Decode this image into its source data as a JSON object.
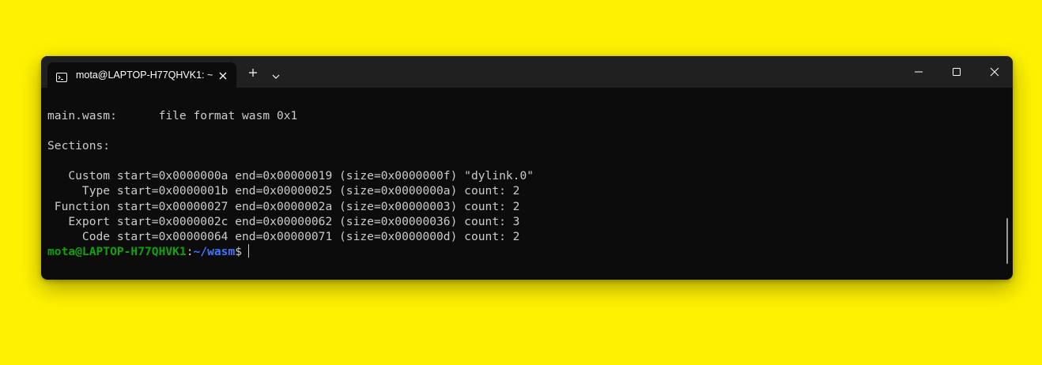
{
  "tab": {
    "title": "mota@LAPTOP-H77QHVK1: ~",
    "icon": "terminal-icon"
  },
  "titlebar": {
    "new_tab_icon": "plus-icon",
    "dropdown_icon": "chevron-down-icon",
    "minimize_icon": "minimize-icon",
    "maximize_icon": "maximize-icon",
    "close_icon": "close-icon"
  },
  "terminal": {
    "lines": [
      "main.wasm:      file format wasm 0x1",
      "",
      "Sections:",
      "",
      "   Custom start=0x0000000a end=0x00000019 (size=0x0000000f) \"dylink.0\"",
      "     Type start=0x0000001b end=0x00000025 (size=0x0000000a) count: 2",
      " Function start=0x00000027 end=0x0000002a (size=0x00000003) count: 2",
      "   Export start=0x0000002c end=0x00000062 (size=0x00000036) count: 3",
      "     Code start=0x00000064 end=0x00000071 (size=0x0000000d) count: 2"
    ],
    "prompt": {
      "user_host": "mota@LAPTOP-H77QHVK1",
      "separator": ":",
      "path": "~/wasm",
      "symbol": "$"
    }
  },
  "colors": {
    "background": "#fff200",
    "terminal_bg": "#0c0c0c",
    "titlebar_bg": "#202020",
    "text": "#cccccc",
    "prompt_user": "#13a10e",
    "prompt_path": "#3b78ff"
  }
}
